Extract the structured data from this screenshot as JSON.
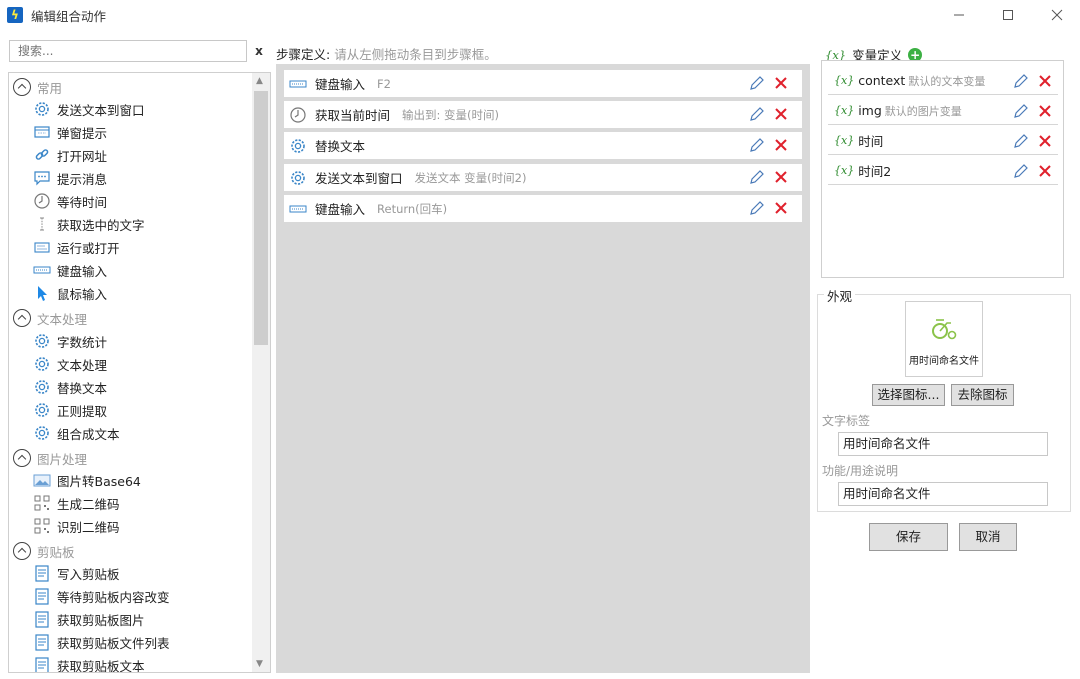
{
  "window": {
    "title": "编辑组合动作"
  },
  "search": {
    "placeholder": "搜索...",
    "clear_label": "x"
  },
  "groups": [
    {
      "label": "常用",
      "items": [
        "发送文本到窗口",
        "弹窗提示",
        "打开网址",
        "提示消息",
        "等待时间",
        "获取选中的文字",
        "运行或打开",
        "键盘输入",
        "鼠标输入"
      ]
    },
    {
      "label": "文本处理",
      "items": [
        "字数统计",
        "文本处理",
        "替换文本",
        "正则提取",
        "组合成文本"
      ]
    },
    {
      "label": "图片处理",
      "items": [
        "图片转Base64",
        "生成二维码",
        "识别二维码"
      ]
    },
    {
      "label": "剪贴板",
      "items": [
        "写入剪贴板",
        "等待剪贴板内容改变",
        "获取剪贴板图片",
        "获取剪贴板文件列表",
        "获取剪贴板文本"
      ]
    }
  ],
  "steps": {
    "label": "步骤定义:",
    "hint": "请从左侧拖动条目到步骤框。",
    "items": [
      {
        "name": "键盘输入",
        "detail": "F2",
        "icon": "keyboard-icon"
      },
      {
        "name": "获取当前时间",
        "detail": "输出到: 变量(时间)",
        "icon": "clock-icon"
      },
      {
        "name": "替换文本",
        "detail": "",
        "icon": "gear-icon"
      },
      {
        "name": "发送文本到窗口",
        "detail": "发送文本 变量(时间2)",
        "icon": "gear-icon"
      },
      {
        "name": "键盘输入",
        "detail": "Return(回车)",
        "icon": "keyboard-icon"
      }
    ]
  },
  "variables": {
    "header": "变量定义",
    "symbol": "{x}",
    "items": [
      {
        "name": "context",
        "desc": "默认的文本变量"
      },
      {
        "name": "img",
        "desc": "默认的图片变量"
      },
      {
        "name": "时间",
        "desc": ""
      },
      {
        "name": "时间2",
        "desc": ""
      }
    ]
  },
  "appearance": {
    "label": "外观",
    "preview_caption": "用时间命名文件",
    "select_icon": "选择图标...",
    "remove_icon": "去除图标",
    "text_label_title": "文字标签",
    "text_label_value": "用时间命名文件",
    "desc_title": "功能/用途说明",
    "desc_value": "用时间命名文件"
  },
  "actions": {
    "save": "保存",
    "cancel": "取消"
  },
  "colors": {
    "accent_green": "#3cb043",
    "delete_red": "#e0212c",
    "edit_blue": "#4a7ab8",
    "steps_bg": "#d9d9d9"
  }
}
